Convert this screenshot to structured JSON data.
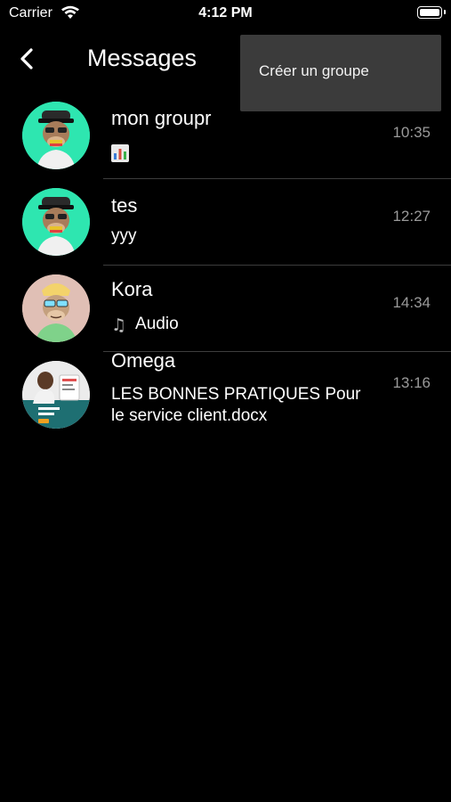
{
  "status_bar": {
    "carrier": "Carrier",
    "time": "4:12 PM"
  },
  "header": {
    "title": "Messages"
  },
  "menu": {
    "items": [
      {
        "label": "Créer un groupe"
      }
    ]
  },
  "conversations": [
    {
      "name": "mon groupr",
      "preview": "",
      "preview_icon": "bar-chart-icon",
      "time": "10:35"
    },
    {
      "name": "tes",
      "preview": "yyy",
      "time": "12:27"
    },
    {
      "name": "Kora",
      "preview": "Audio",
      "preview_icon": "music-note-icon",
      "time": "14:34"
    },
    {
      "name": "Omega",
      "preview": "LES BONNES PRATIQUES Pour le service client.docx",
      "time": "13:16"
    }
  ],
  "colors": {
    "background": "#000000",
    "menu_background": "#3b3b3b",
    "timestamp": "#9a9a9a",
    "divider": "#3d3d3d"
  }
}
